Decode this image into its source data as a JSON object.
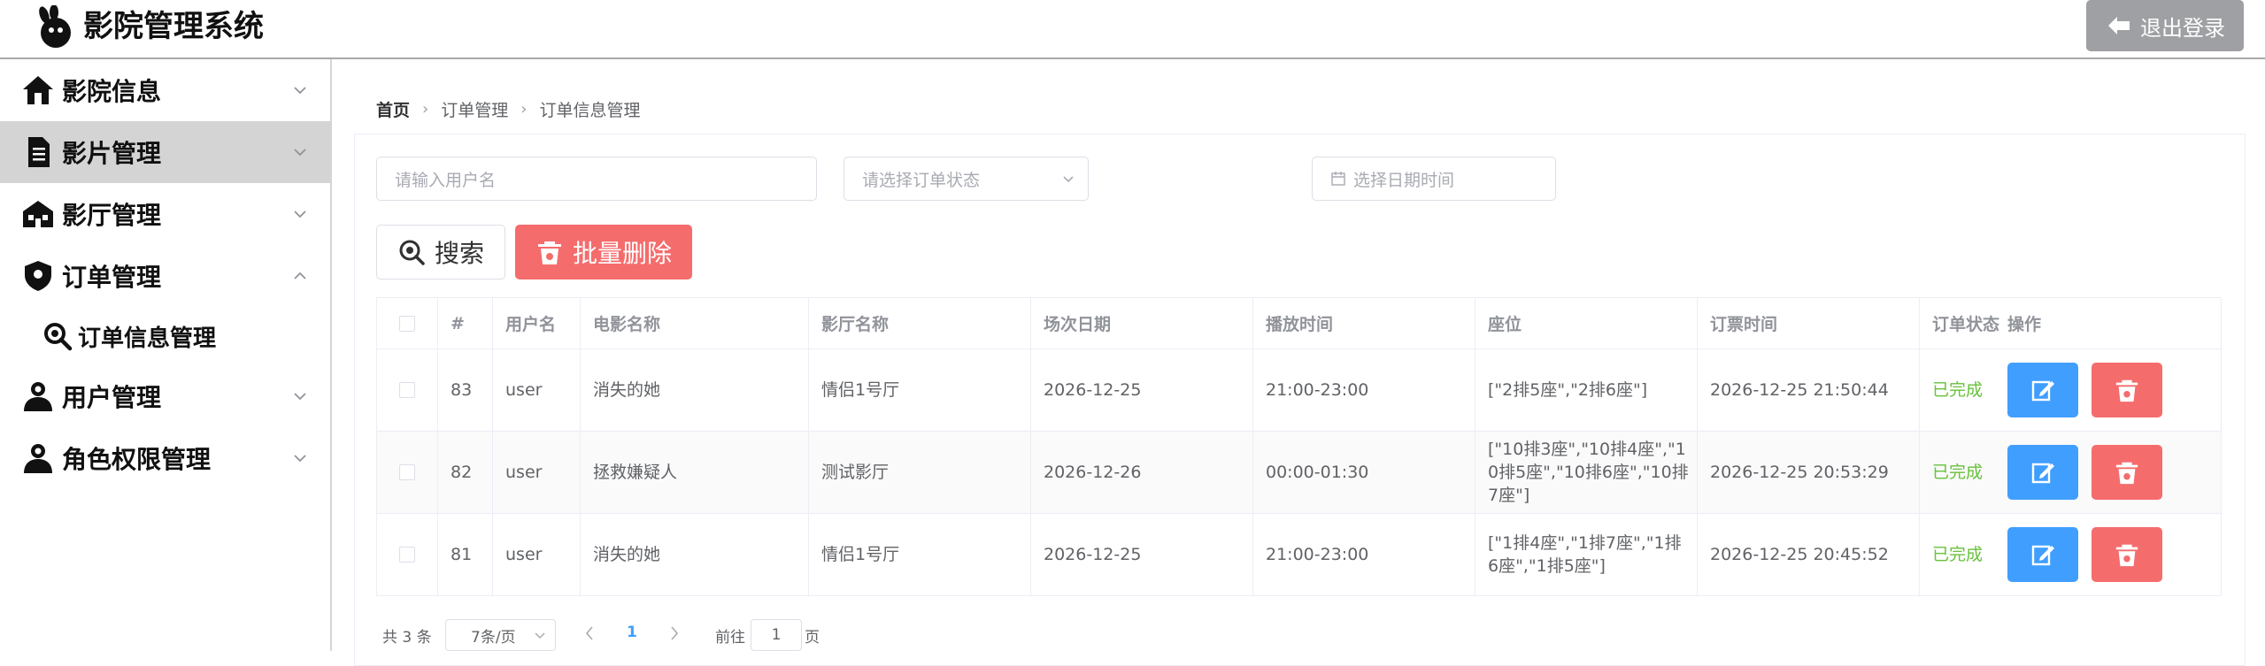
{
  "header": {
    "title": "影院管理系统",
    "logout_label": "退出登录"
  },
  "sidebar": {
    "items": [
      {
        "label": "影院信息",
        "icon": "home-icon"
      },
      {
        "label": "影片管理",
        "icon": "document-icon"
      },
      {
        "label": "影厅管理",
        "icon": "building-icon"
      },
      {
        "label": "订单管理",
        "icon": "shield-icon"
      },
      {
        "label": "用户管理",
        "icon": "user-icon"
      },
      {
        "label": "角色权限管理",
        "icon": "user-icon"
      }
    ],
    "subitems": [
      {
        "label": "订单信息管理",
        "icon": "search-icon"
      }
    ]
  },
  "breadcrumb": {
    "home": "首页",
    "level2": "订单管理",
    "level3": "订单信息管理"
  },
  "filters": {
    "username_placeholder": "请输入用户名",
    "status_placeholder": "请选择订单状态",
    "date_placeholder": "选择日期时间"
  },
  "actions": {
    "search_label": "搜索",
    "bulk_delete_label": "批量删除"
  },
  "table": {
    "headers": [
      "#",
      "用户名",
      "电影名称",
      "影厅名称",
      "场次日期",
      "播放时间",
      "座位",
      "订票时间",
      "订单状态",
      "操作"
    ],
    "rows": [
      {
        "id": "83",
        "user": "user",
        "movie": "消失的她",
        "hall": "情侣1号厅",
        "date": "2026-12-25",
        "time": "21:00-23:00",
        "seats": "[\"2排5座\",\"2排6座\"]",
        "booked": "2026-12-25 21:50:44",
        "status": "已完成"
      },
      {
        "id": "82",
        "user": "user",
        "movie": "拯救嫌疑人",
        "hall": "测试影厅",
        "date": "2026-12-26",
        "time": "00:00-01:30",
        "seats": "[\"10排3座\",\"10排4座\",\"10排5座\",\"10排6座\",\"10排7座\"]",
        "booked": "2026-12-25 20:53:29",
        "status": "已完成"
      },
      {
        "id": "81",
        "user": "user",
        "movie": "消失的她",
        "hall": "情侣1号厅",
        "date": "2026-12-25",
        "time": "21:00-23:00",
        "seats": "[\"1排4座\",\"1排7座\",\"1排6座\",\"1排5座\"]",
        "booked": "2026-12-25 20:45:52",
        "status": "已完成"
      }
    ]
  },
  "pagination": {
    "total": "共 3 条",
    "page_size": "7条/页",
    "current": "1",
    "goto_prefix": "前往",
    "goto_value": "1",
    "goto_suffix": "页"
  },
  "colors": {
    "primary": "#409eff",
    "danger": "#f56c6c",
    "success": "#67c23a",
    "logout_bg": "#9ea0a3"
  }
}
